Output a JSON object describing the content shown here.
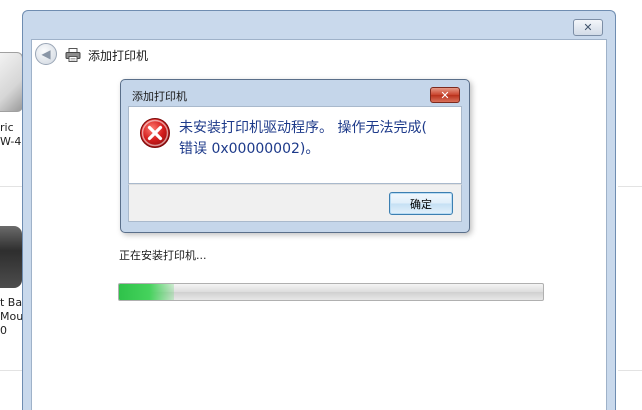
{
  "background_window": {
    "device1_label": "ric\nW-4",
    "device2_label": "t Ba\nMou\n0"
  },
  "wizard": {
    "close_label": "✕",
    "back_label": "◀",
    "nav_title": "添加打印机",
    "status_text": "正在安装打印机...",
    "progress": 0.13
  },
  "dialog": {
    "title": "添加打印机",
    "close_label": "✕",
    "message_line1": "未安装打印机驱动程序。 操作无法完成(",
    "message_line2": "错误 0x00000002)。",
    "ok_label": "确定"
  },
  "colors": {
    "message": "#1d3a8a",
    "progress": "#2fc24a",
    "error_icon": "#c8141b"
  },
  "icons": {
    "back": "back-arrow-icon",
    "printer": "printer-icon",
    "error": "error-icon",
    "close": "close-icon"
  }
}
